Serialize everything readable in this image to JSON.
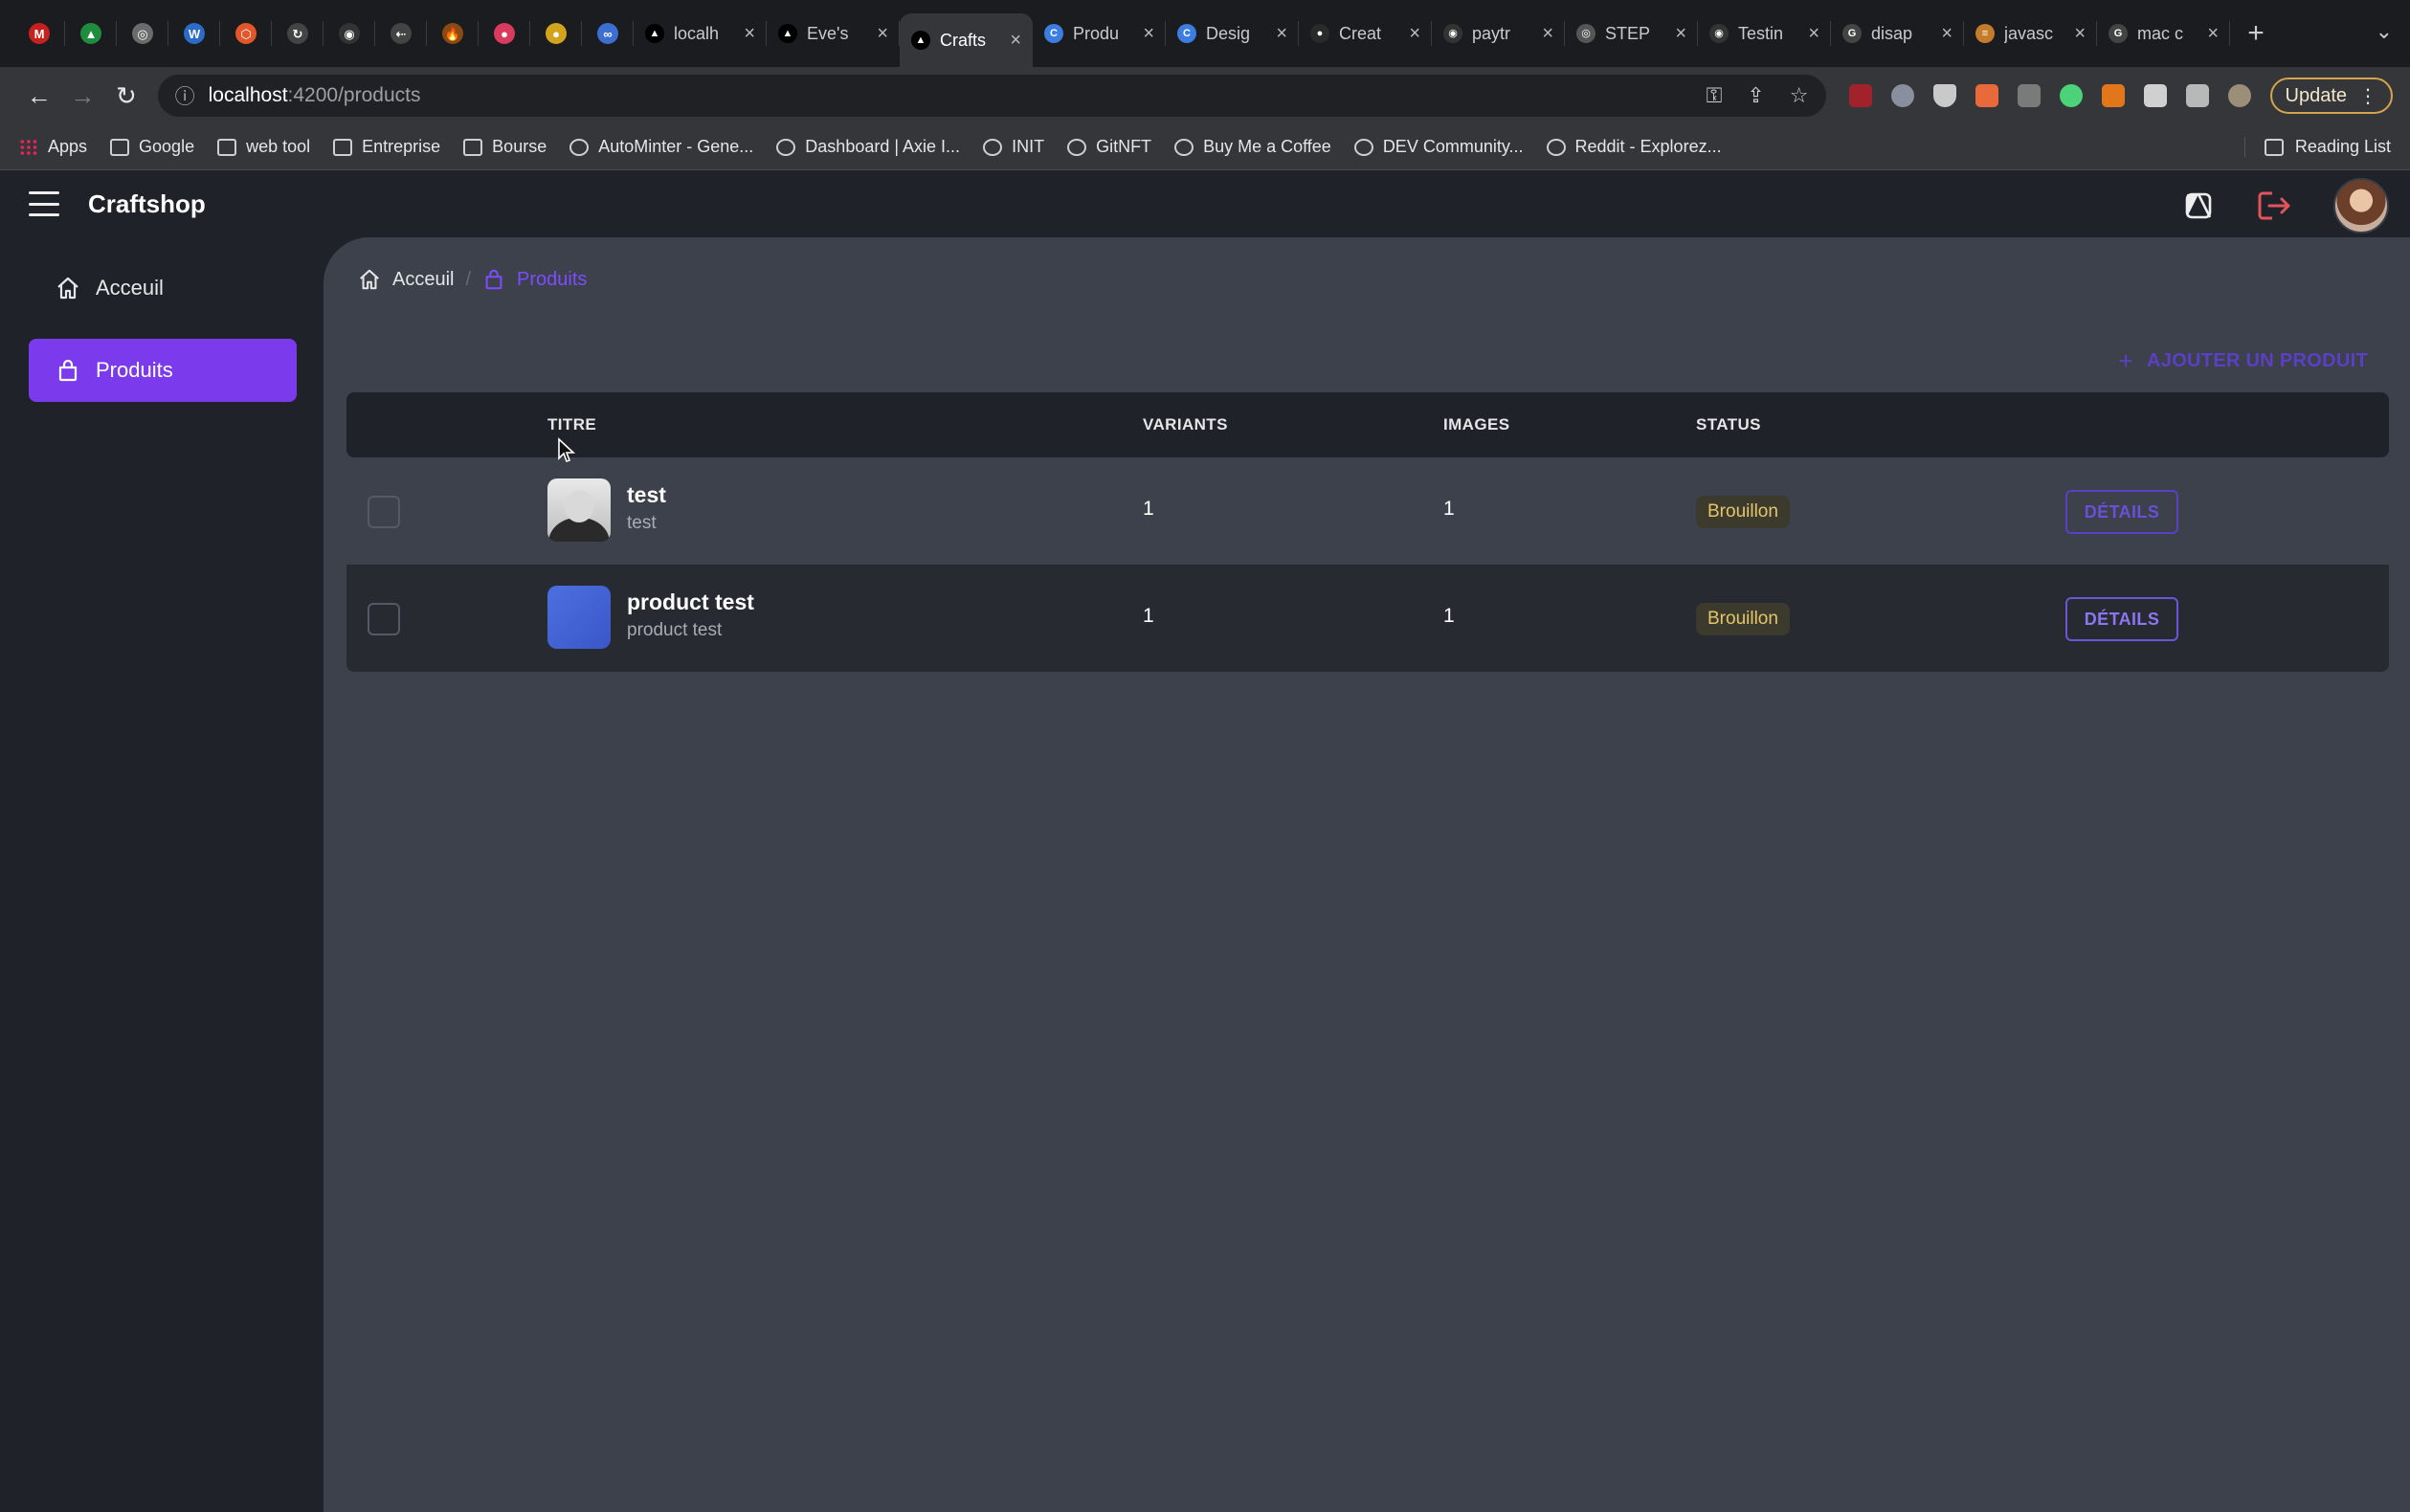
{
  "browser": {
    "pinned_tabs": [
      {
        "icon": "gmail-icon",
        "glyph": "M",
        "color": "#c5221f"
      },
      {
        "icon": "drive-icon",
        "glyph": "▲",
        "color": "#1e8e3e"
      },
      {
        "icon": "globe-icon",
        "glyph": "◎",
        "color": "#6b6b6b"
      },
      {
        "icon": "wordpress-icon",
        "glyph": "W",
        "color": "#2a6cc7"
      },
      {
        "icon": "hexagon-icon",
        "glyph": "⬡",
        "color": "#e2572a"
      },
      {
        "icon": "refresh-app-icon",
        "glyph": "↻",
        "color": "#444"
      },
      {
        "icon": "github-icon",
        "glyph": "◉",
        "color": "#333"
      },
      {
        "icon": "arrows-icon",
        "glyph": "⇠",
        "color": "#444"
      },
      {
        "icon": "flame-icon",
        "glyph": "🔥",
        "color": "#8a4a12"
      },
      {
        "icon": "record-icon",
        "glyph": "●",
        "color": "#d93a5e"
      },
      {
        "icon": "coin-icon",
        "glyph": "●",
        "color": "#d2a31c"
      },
      {
        "icon": "infinity-icon",
        "glyph": "∞",
        "color": "#3c6fd1"
      }
    ],
    "tabs": [
      {
        "label": "localh",
        "icon": "vercel-icon",
        "glyph": "▲",
        "color": "#000",
        "active": false
      },
      {
        "label": "Eve's",
        "icon": "vercel-icon",
        "glyph": "▲",
        "color": "#000",
        "active": false
      },
      {
        "label": "Crafts",
        "icon": "vercel-icon",
        "glyph": "▲",
        "color": "#000",
        "active": true
      },
      {
        "label": "Produ",
        "icon": "c-logo-icon",
        "glyph": "C",
        "color": "#3b7de0",
        "active": false
      },
      {
        "label": "Desig",
        "icon": "c-logo-icon",
        "glyph": "C",
        "color": "#3b7de0",
        "active": false
      },
      {
        "label": "Creat",
        "icon": "dot-red-icon",
        "glyph": "●",
        "color": "#2a2a2a",
        "active": false
      },
      {
        "label": "paytr",
        "icon": "github-icon",
        "glyph": "◉",
        "color": "#333",
        "active": false
      },
      {
        "label": "STEP",
        "icon": "globe-icon",
        "glyph": "◎",
        "color": "#555",
        "active": false
      },
      {
        "label": "Testin",
        "icon": "github-icon",
        "glyph": "◉",
        "color": "#333",
        "active": false
      },
      {
        "label": "disap",
        "icon": "google-icon",
        "glyph": "G",
        "color": "#444",
        "active": false
      },
      {
        "label": "javasc",
        "icon": "stack-icon",
        "glyph": "≡",
        "color": "#c47b2a",
        "active": false
      },
      {
        "label": "mac c",
        "icon": "google-icon",
        "glyph": "G",
        "color": "#444",
        "active": false
      }
    ],
    "url_host": "localhost",
    "url_path": ":4200/products",
    "update_label": "Update",
    "bookmarks": [
      {
        "label": "Apps",
        "icon": "apps-grid-icon"
      },
      {
        "label": "Google",
        "icon": "folder-icon"
      },
      {
        "label": "web tool",
        "icon": "folder-icon"
      },
      {
        "label": "Entreprise",
        "icon": "folder-icon"
      },
      {
        "label": "Bourse",
        "icon": "folder-icon"
      },
      {
        "label": "AutoMinter - Gene...",
        "icon": "autominter-icon"
      },
      {
        "label": "Dashboard | Axie I...",
        "icon": "axie-icon"
      },
      {
        "label": "INIT",
        "icon": "globe-icon"
      },
      {
        "label": "GitNFT",
        "icon": "gitnft-icon"
      },
      {
        "label": "Buy Me a Coffee",
        "icon": "coffee-icon"
      },
      {
        "label": "DEV Community...",
        "icon": "dev-icon"
      },
      {
        "label": "Reddit - Explorez...",
        "icon": "reddit-icon"
      }
    ],
    "reading_list": "Reading List"
  },
  "app": {
    "brand": "Craftshop",
    "accent": "#7c3aed",
    "sidebar": [
      {
        "label": "Acceuil",
        "icon": "home-icon",
        "active": false
      },
      {
        "label": "Produits",
        "icon": "bag-icon",
        "active": true
      }
    ],
    "breadcrumbs": [
      {
        "label": "Acceuil",
        "icon": "home-icon"
      },
      {
        "label": "Produits",
        "icon": "bag-icon"
      }
    ],
    "add_button": "AJOUTER UN PRODUIT",
    "table": {
      "headers": [
        "TITRE",
        "VARIANTS",
        "IMAGES",
        "STATUS"
      ],
      "rows": [
        {
          "title": "test",
          "subtitle": "test",
          "variants": "1",
          "images": "1",
          "status": "Brouillon",
          "action": "DÉTAILS",
          "thumb": "photo"
        },
        {
          "title": "product test",
          "subtitle": "product test",
          "variants": "1",
          "images": "1",
          "status": "Brouillon",
          "action": "DÉTAILS",
          "thumb": "blue"
        }
      ]
    }
  }
}
